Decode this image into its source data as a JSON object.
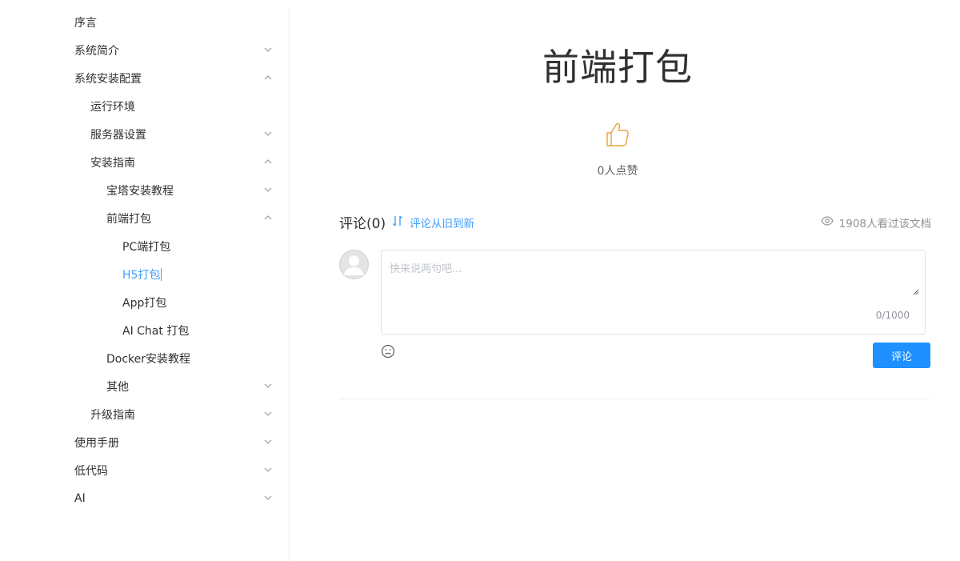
{
  "sidebar": {
    "items": [
      {
        "label": "序言"
      },
      {
        "label": "系统简介"
      },
      {
        "label": "系统安装配置"
      },
      {
        "label": "运行环境"
      },
      {
        "label": "服务器设置"
      },
      {
        "label": "安装指南"
      },
      {
        "label": "宝塔安装教程"
      },
      {
        "label": "前端打包"
      },
      {
        "label": "PC端打包"
      },
      {
        "label": "H5打包"
      },
      {
        "label": "App打包"
      },
      {
        "label": "AI Chat 打包"
      },
      {
        "label": "Docker安装教程"
      },
      {
        "label": "其他"
      },
      {
        "label": "升级指南"
      },
      {
        "label": "使用手册"
      },
      {
        "label": "低代码"
      },
      {
        "label": "AI"
      }
    ]
  },
  "main": {
    "title": "前端打包",
    "like_count": "0人点赞"
  },
  "comments": {
    "title": "评论(0)",
    "sort_label": "评论从旧到新",
    "views": "1908人看过该文档",
    "placeholder": "快来说两句吧...",
    "char_count": "0/1000",
    "submit_label": "评论"
  },
  "colors": {
    "accent": "#409eff",
    "button": "#1e90ff",
    "like_icon": "#e6a23c"
  }
}
